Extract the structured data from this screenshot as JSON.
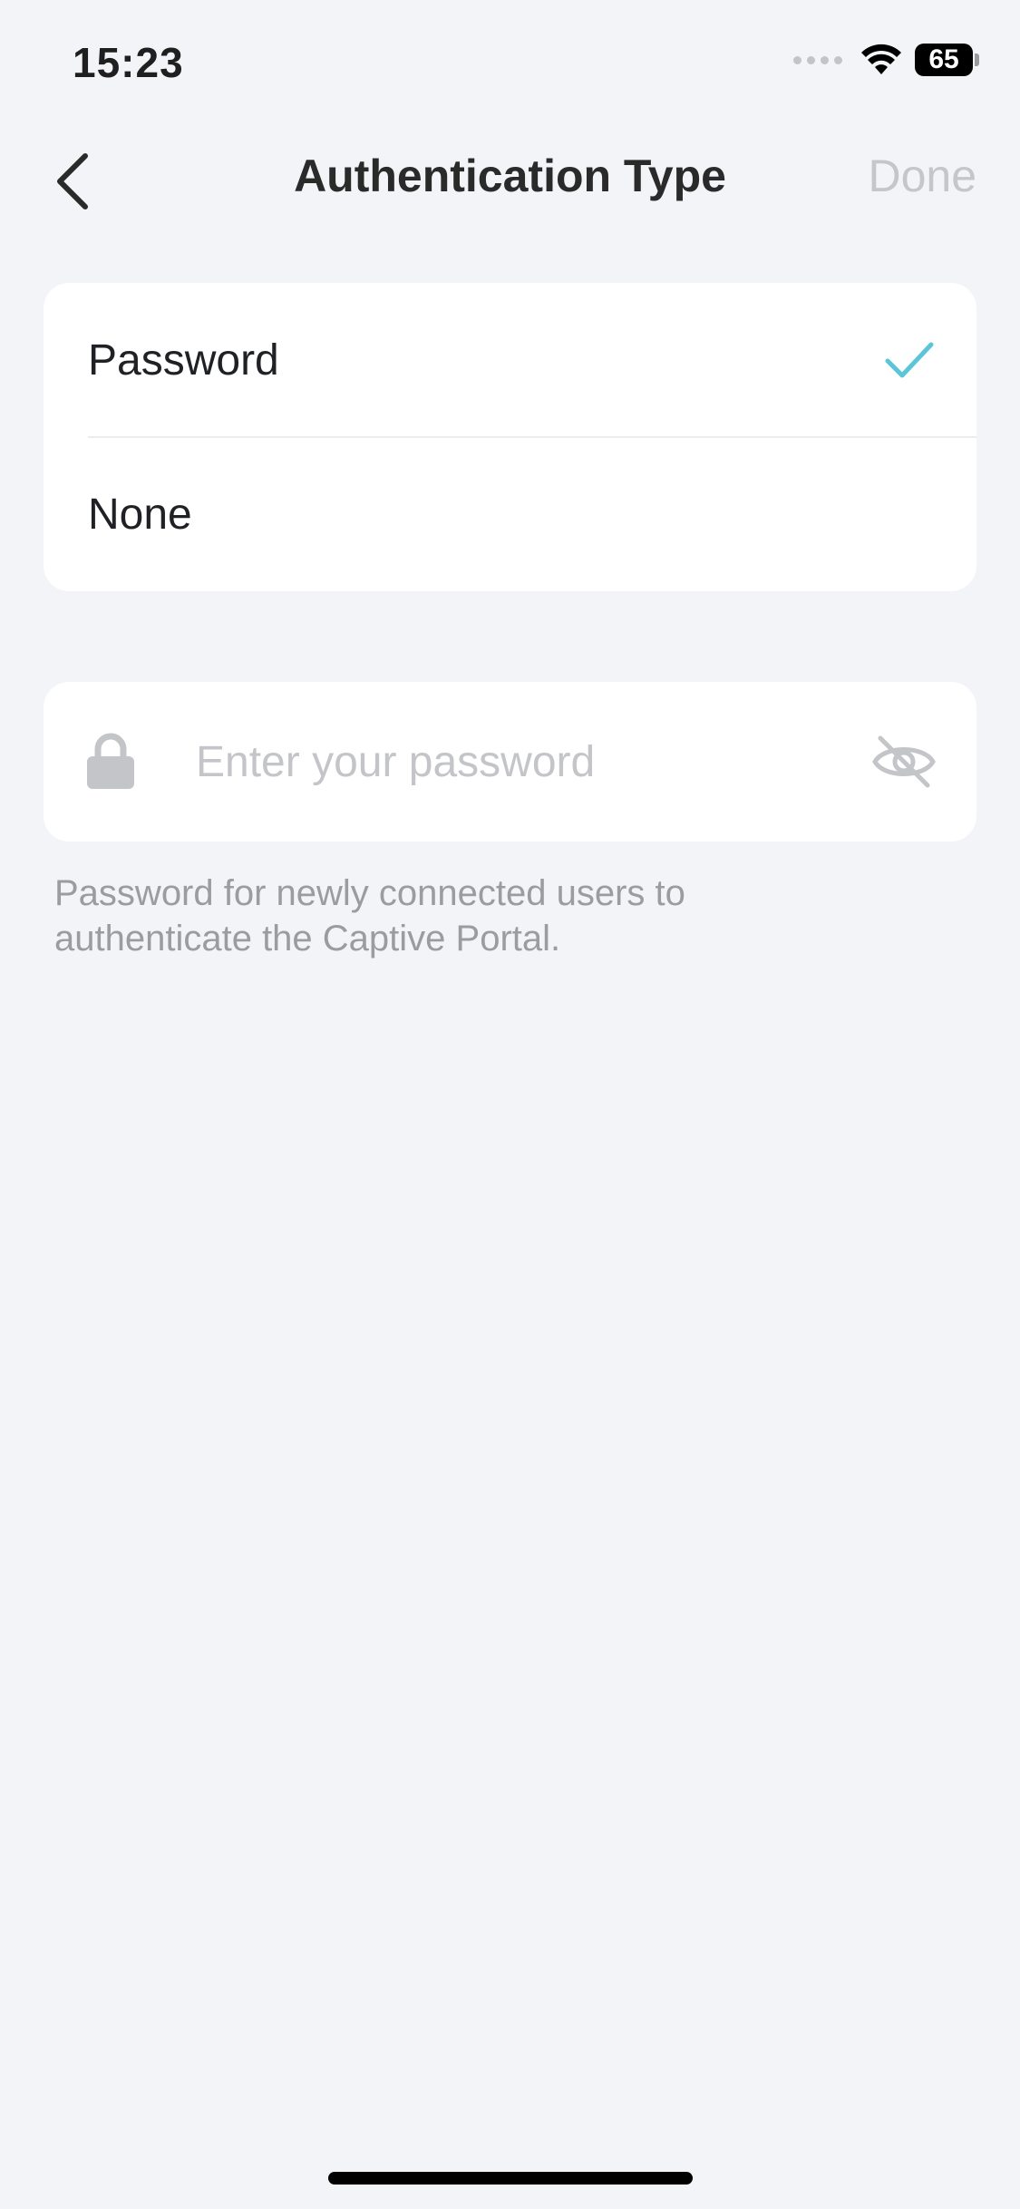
{
  "status_bar": {
    "time": "15:23",
    "battery": "65",
    "icons": [
      "signal-dots-icon",
      "wifi-icon",
      "battery-icon"
    ]
  },
  "nav": {
    "title": "Authentication Type",
    "done_label": "Done",
    "back_icon": "chevron-left-icon"
  },
  "options": [
    {
      "label": "Password",
      "selected": true
    },
    {
      "label": "None",
      "selected": false
    }
  ],
  "password_field": {
    "value": "",
    "placeholder": "Enter your password",
    "lead_icon": "lock-icon",
    "trail_icon": "eye-off-icon"
  },
  "helper_text": "Password for newly connected users to authenticate the Captive Portal.",
  "colors": {
    "background": "#f3f4f8",
    "check_accent": "#5cc6d8",
    "done_disabled": "#c6c6ca",
    "placeholder": "#c4c5c9"
  }
}
